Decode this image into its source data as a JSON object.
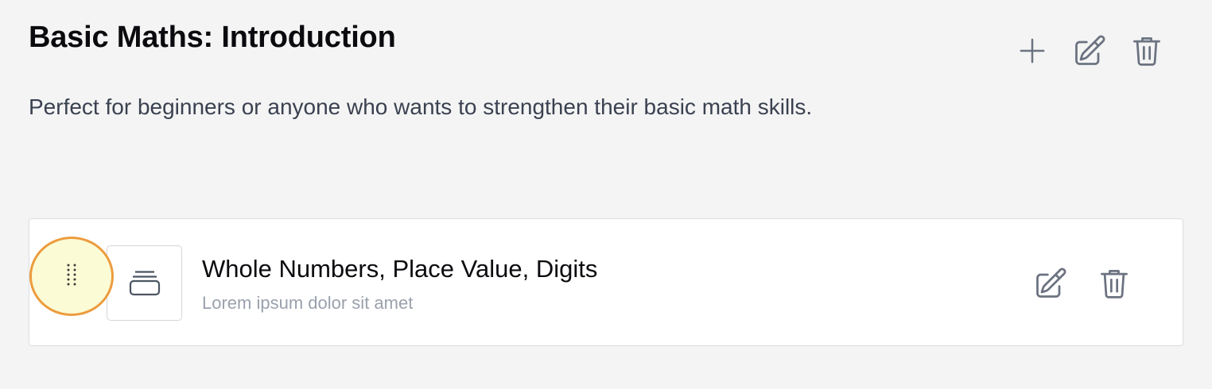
{
  "section": {
    "title": "Basic Maths: Introduction",
    "description": "Perfect for beginners or anyone who wants to strengthen their basic math skills.",
    "actions": {
      "add_icon": "plus-icon",
      "edit_icon": "pencil-square-icon",
      "delete_icon": "trash-icon"
    }
  },
  "lesson": {
    "title": "Whole Numbers, Place Value, Digits",
    "subtitle": "Lorem ipsum dolor sit amet",
    "handle_icon": "drag-dots-icon",
    "thumb_icon": "stack-icon",
    "actions": {
      "edit_icon": "pencil-square-icon",
      "delete_icon": "trash-icon"
    }
  },
  "colors": {
    "background": "#f4f4f4",
    "card_border": "#dcdde0",
    "handle_fill": "#fbfcd6",
    "handle_ring": "#ec9c3e",
    "icon": "#6b7280",
    "muted_text": "#9aa1ac"
  }
}
